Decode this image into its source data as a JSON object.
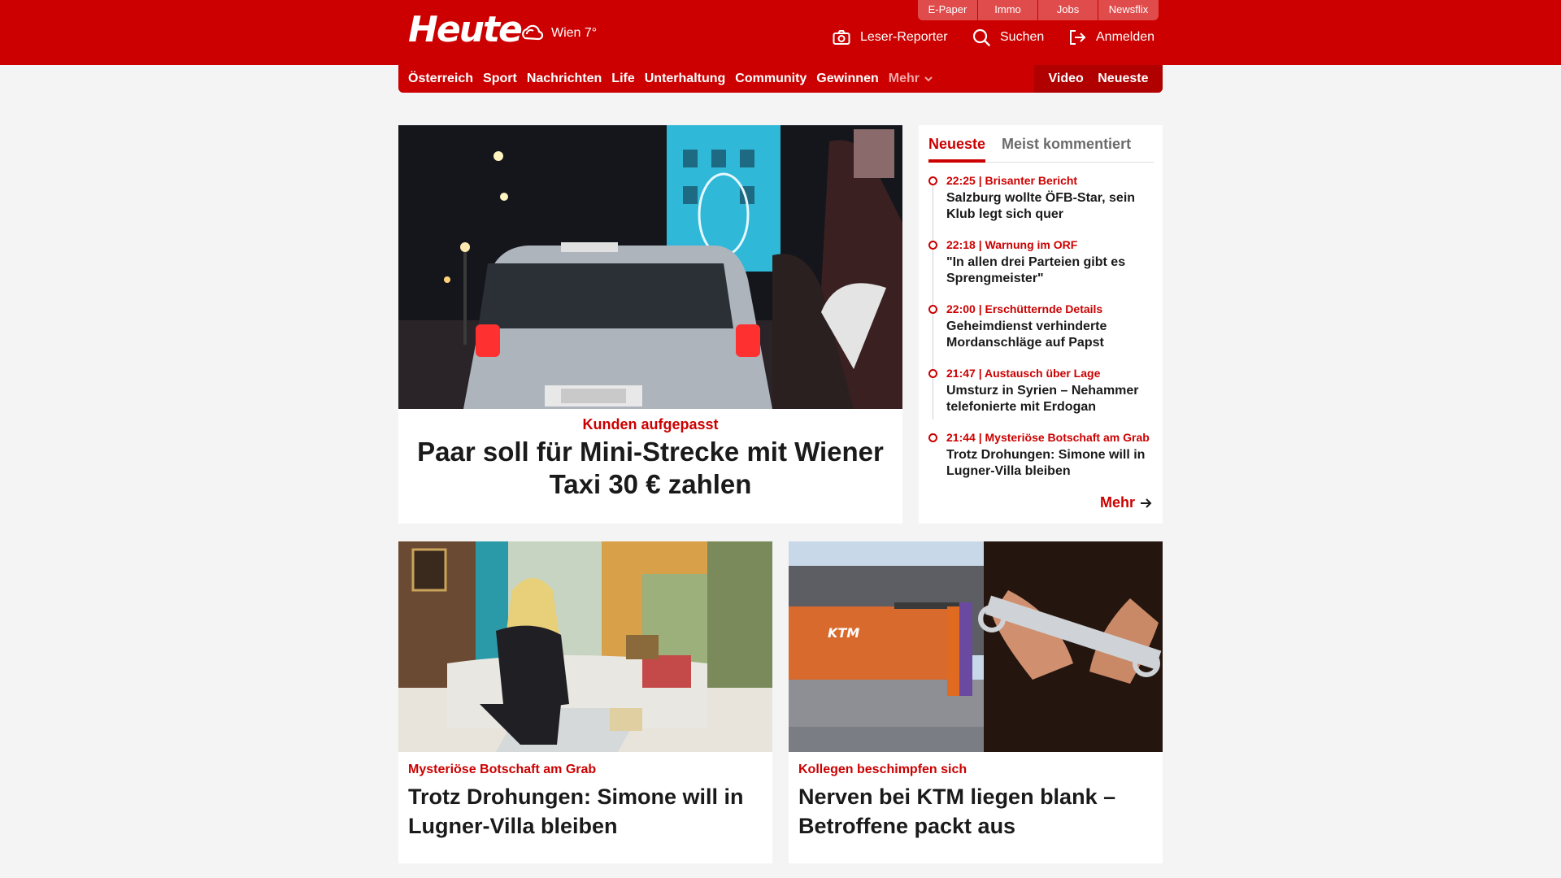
{
  "header": {
    "logo": "Heute",
    "weather": "Wien 7°",
    "sitelinks": [
      "E-Paper",
      "Immo",
      "Jobs",
      "Newsflix"
    ],
    "leser_reporter": "Leser-Reporter",
    "search": "Suchen",
    "login": "Anmelden"
  },
  "nav": {
    "items": [
      "Österreich",
      "Sport",
      "Nachrichten",
      "Life",
      "Unterhaltung",
      "Community",
      "Gewinnen"
    ],
    "more": "Mehr",
    "video": "Video",
    "latest": "Neueste"
  },
  "hero": {
    "kicker": "Kunden aufgepasst",
    "title": "Paar soll für Mini-Strecke mit Wiener Taxi 30 € zahlen"
  },
  "sidebar": {
    "tabs": [
      "Neueste",
      "Meist kommentiert"
    ],
    "items": [
      {
        "meta": "22:25 | Brisanter Bericht",
        "title": "Salzburg wollte ÖFB-Star, sein Klub legt sich quer"
      },
      {
        "meta": "22:18 | Warnung im ORF",
        "title": "\"In allen drei Parteien gibt es Sprengmeister\""
      },
      {
        "meta": "22:00 | Erschütternde Details",
        "title": "Geheimdienst verhinderte Mordanschläge auf Papst"
      },
      {
        "meta": "21:47 | Austausch über Lage",
        "title": "Umsturz in Syrien – Nehammer telefonierte mit Erdogan"
      },
      {
        "meta": "21:44 | Mysteriöse Botschaft am Grab",
        "title": "Trotz Drohungen: Simone will in Lugner-Villa bleiben"
      }
    ],
    "more": "Mehr"
  },
  "cards": [
    {
      "kicker": "Mysteriöse Botschaft am Grab",
      "title": "Trotz Drohungen: Simone will in Lugner-Villa bleiben"
    },
    {
      "kicker": "Kollegen beschimpfen sich",
      "title": "Nerven bei KTM liegen blank – Betroffene packt aus"
    }
  ],
  "colors": {
    "brand": "#cc0000",
    "background": "#f4f4f4"
  }
}
